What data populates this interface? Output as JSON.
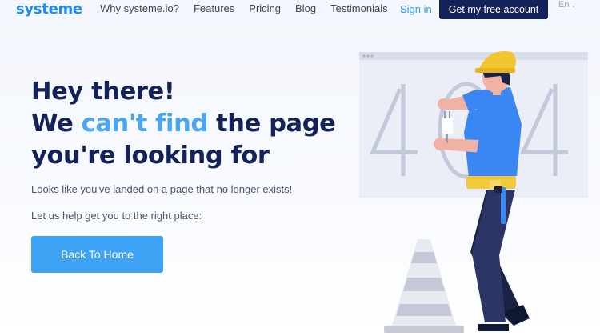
{
  "header": {
    "logo": "systeme",
    "nav": [
      "Why systeme.io?",
      "Features",
      "Pricing",
      "Blog",
      "Testimonials"
    ],
    "sign_in": "Sign in",
    "cta": "Get my free account",
    "language": "En"
  },
  "hero": {
    "line1": "Hey there!",
    "line2_start": "We ",
    "line2_accent": "can't find",
    "line2_end": " the page",
    "line3": "you're looking for",
    "subtext1": "Looks like you've landed on a page that no longer exists!",
    "subtext2": "Let us help get you to the right place:",
    "button": "Back To Home"
  },
  "colors": {
    "brand_navy": "#13235a",
    "accent_blue": "#49a7f1",
    "button_blue": "#3ea3f5"
  },
  "illustration": {
    "error_code": "404",
    "icons": [
      "browser-window",
      "worker",
      "traffic-cone",
      "plug"
    ]
  }
}
